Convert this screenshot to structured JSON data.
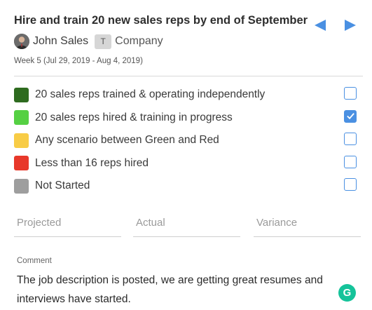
{
  "header": {
    "title": "Hire and train 20 new sales reps by end of September",
    "owner_name": "John Sales",
    "company_badge": "T",
    "company_name": "Company",
    "week": "Week 5 (Jul 29, 2019 - Aug 4, 2019)",
    "nav_color": "#4a90e2"
  },
  "statuses": [
    {
      "label": "20 sales reps trained & operating independently",
      "color": "#2e6b1f",
      "checked": false
    },
    {
      "label": "20 sales reps hired & training in progress",
      "color": "#55d043",
      "checked": true
    },
    {
      "label": "Any scenario between Green and Red",
      "color": "#f8cc46",
      "checked": false
    },
    {
      "label": "Less than 16 reps hired",
      "color": "#e8382a",
      "checked": false
    },
    {
      "label": "Not Started",
      "color": "#9e9e9e",
      "checked": false
    }
  ],
  "metrics": {
    "projected_placeholder": "Projected",
    "actual_placeholder": "Actual",
    "variance_placeholder": "Variance"
  },
  "comment": {
    "label": "Comment",
    "text": "The job description is posted, we are getting great resumes and interviews have started.",
    "grammarly_letter": "G"
  }
}
